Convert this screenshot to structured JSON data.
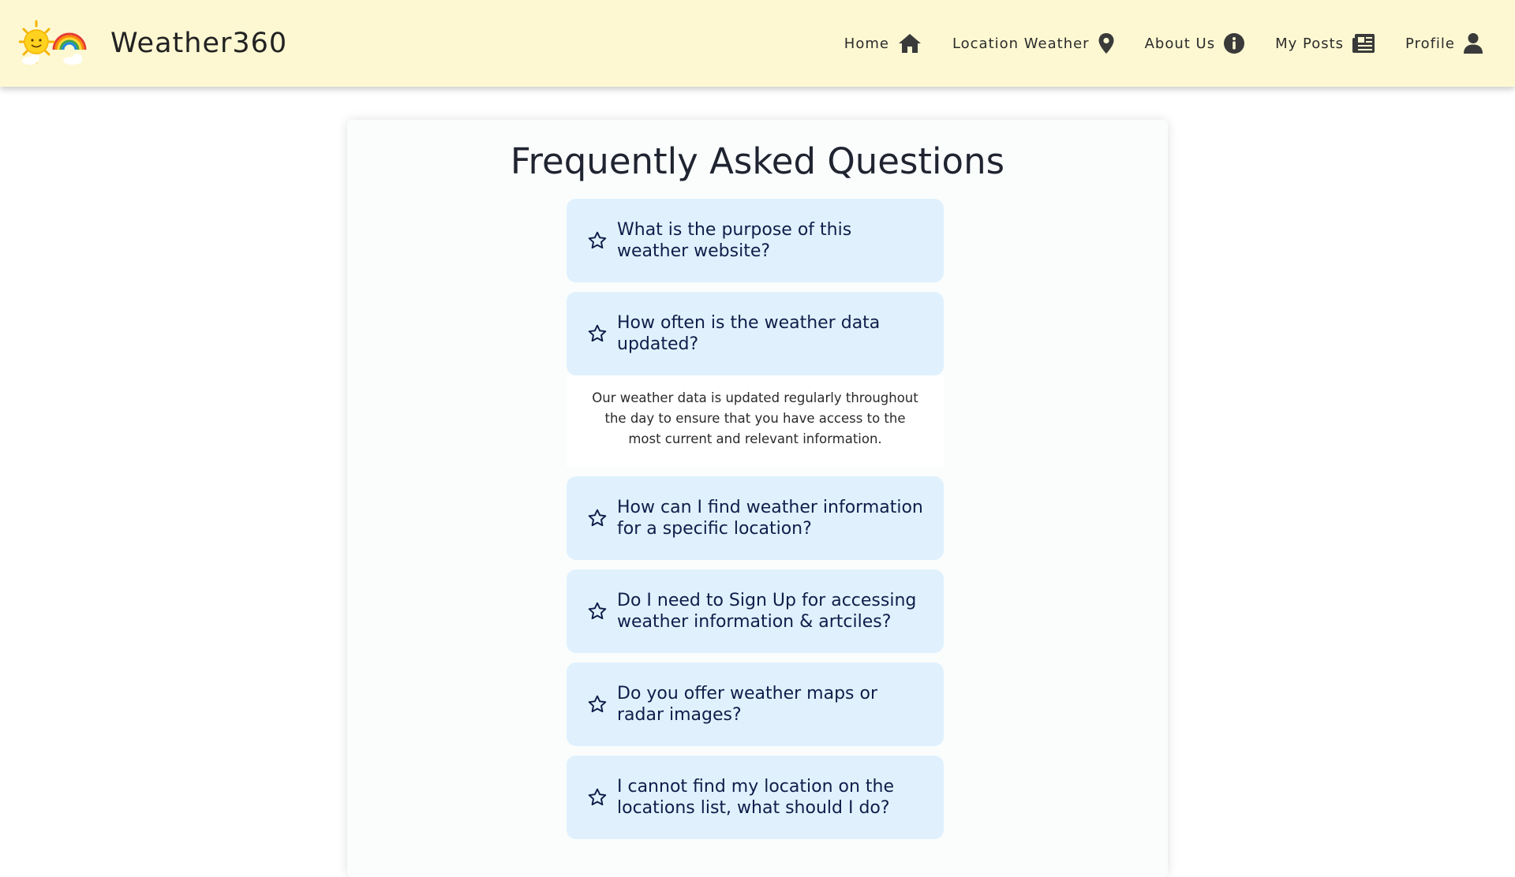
{
  "header": {
    "brand": "Weather360",
    "nav": [
      {
        "label": "Home",
        "icon": "home-icon"
      },
      {
        "label": "Location Weather",
        "icon": "map-pin-icon"
      },
      {
        "label": "About Us",
        "icon": "info-icon"
      },
      {
        "label": "My Posts",
        "icon": "newspaper-icon"
      },
      {
        "label": "Profile",
        "icon": "user-icon"
      }
    ]
  },
  "faq": {
    "title": "Frequently Asked Questions",
    "items": [
      {
        "question": "What is the purpose of this weather website?",
        "answer": null
      },
      {
        "question": "How often is the weather data updated?",
        "answer": "Our weather data is updated regularly throughout the day to ensure that you have access to the most current and relevant information."
      },
      {
        "question": "How can I find weather information for a specific location?",
        "answer": null
      },
      {
        "question": "Do I need to Sign Up for accessing weather information & artciles?",
        "answer": null
      },
      {
        "question": "Do you offer weather maps or radar images?",
        "answer": null
      },
      {
        "question": "I cannot find my location on the locations list, what should I do?",
        "answer": null
      }
    ]
  },
  "colors": {
    "header_bg": "#fdf8d2",
    "question_bg": "#e0f1fd",
    "question_text": "#0f1d4a",
    "icon": "#3a3a3a"
  }
}
